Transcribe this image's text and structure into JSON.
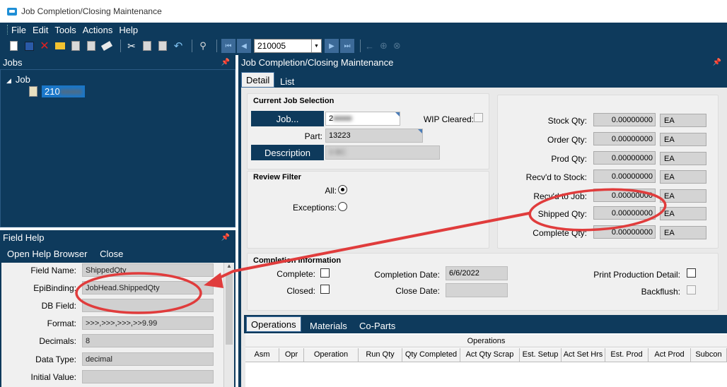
{
  "window": {
    "title": "Job Completion/Closing Maintenance"
  },
  "menu": [
    "File",
    "Edit",
    "Tools",
    "Actions",
    "Help"
  ],
  "toolbar": {
    "job_number": "210005"
  },
  "jobs_pane": {
    "title": "Jobs",
    "root": "Job",
    "child": "210"
  },
  "field_help": {
    "title": "Field Help",
    "open_browser": "Open Help Browser",
    "close": "Close",
    "rows": [
      {
        "label": "Field Name:",
        "value": "ShippedQty"
      },
      {
        "label": "EpiBinding:",
        "value": "JobHead.ShippedQty"
      },
      {
        "label": "DB Field:",
        "value": ""
      },
      {
        "label": "Format:",
        "value": ">>>,>>>,>>>,>>9.99"
      },
      {
        "label": "Decimals:",
        "value": "8"
      },
      {
        "label": "Data Type:",
        "value": "decimal"
      },
      {
        "label": "Initial Value:",
        "value": ""
      }
    ]
  },
  "main": {
    "title": "Job Completion/Closing Maintenance",
    "tabs": {
      "detail": "Detail",
      "list": "List"
    },
    "current_job": {
      "title": "Current Job Selection",
      "job_button": "Job...",
      "job_value": "2",
      "wip_label": "WIP Cleared:",
      "part_label": "Part:",
      "part_value": "13223",
      "desc_button": "Description",
      "desc_value": "3                                  BC"
    },
    "review_filter": {
      "title": "Review Filter",
      "all": "All:",
      "exceptions": "Exceptions:"
    },
    "quantities": [
      {
        "label": "Stock Qty:",
        "value": "0.00000000",
        "uom": "EA"
      },
      {
        "label": "Order Qty:",
        "value": "0.00000000",
        "uom": "EA"
      },
      {
        "label": "Prod Qty:",
        "value": "0.00000000",
        "uom": "EA"
      },
      {
        "label": "Recv'd to Stock:",
        "value": "0.00000000",
        "uom": "EA"
      },
      {
        "label": "Recv'd to Job:",
        "value": "0.00000000",
        "uom": "EA"
      },
      {
        "label": "Shipped Qty:",
        "value": "0.00000000",
        "uom": "EA"
      },
      {
        "label": "Complete Qty:",
        "value": "0.00000000",
        "uom": "EA"
      }
    ],
    "completion": {
      "title": "Completion Information",
      "complete": "Complete:",
      "closed": "Closed:",
      "completion_date_label": "Completion Date:",
      "completion_date": "6/6/2022",
      "close_date_label": "Close Date:",
      "close_date": "",
      "print_detail": "Print Production Detail:",
      "backflush": "Backflush:"
    },
    "bottom_tabs": {
      "operations": "Operations",
      "materials": "Materials",
      "coparts": "Co-Parts"
    },
    "operations_grid": {
      "title": "Operations",
      "columns": [
        "Asm",
        "Opr",
        "Operation",
        "Run Qty",
        "Qty Completed",
        "Act Qty Scrap",
        "Est. Setup",
        "Act Set Hrs",
        "Est. Prod",
        "Act Prod",
        "Subcon"
      ]
    }
  },
  "colors": {
    "dark_panel": "#0e3a5c",
    "annotation": "#e03c3c"
  }
}
